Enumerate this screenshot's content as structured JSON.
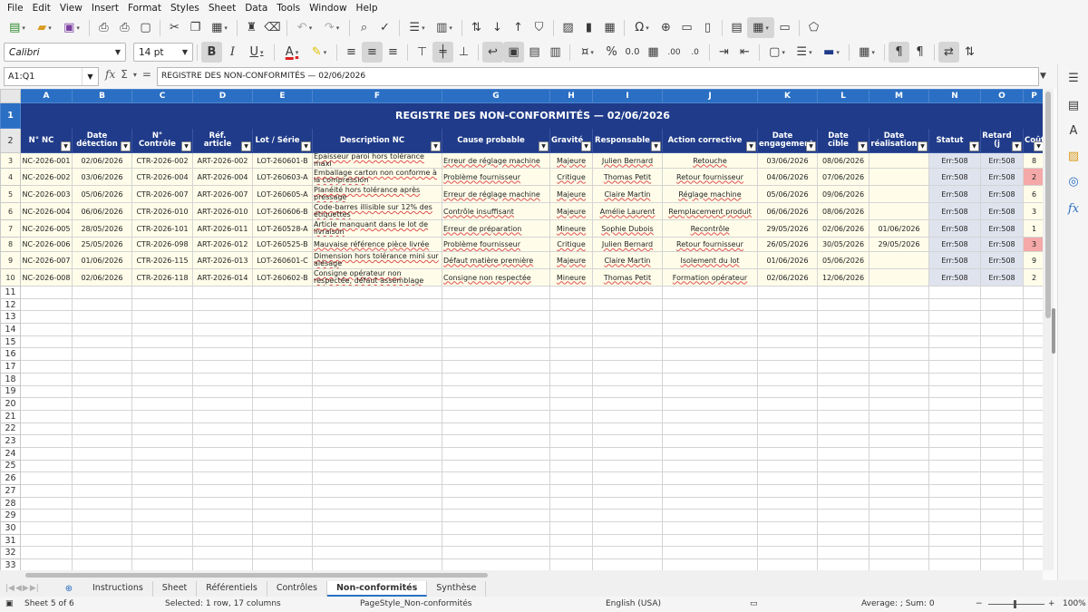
{
  "menu": [
    "File",
    "Edit",
    "View",
    "Insert",
    "Format",
    "Styles",
    "Sheet",
    "Data",
    "Tools",
    "Window",
    "Help"
  ],
  "format_bar": {
    "font_name": "Calibri",
    "font_size": "14 pt"
  },
  "formula_bar": {
    "name_box": "A1:Q1",
    "formula": "REGISTRE DES NON-CONFORMITÉS — 02/06/2026"
  },
  "columns": [
    "A",
    "B",
    "C",
    "D",
    "E",
    "F",
    "G",
    "H",
    "I",
    "J",
    "K",
    "L",
    "M",
    "N",
    "O",
    "P"
  ],
  "sheet": {
    "title": "REGISTRE DES NON-CONFORMITÉS — 02/06/2026",
    "headers": [
      "N° NC",
      "Date détection",
      "N° Contrôle",
      "Réf. article",
      "Lot / Série",
      "Description NC",
      "Cause probable",
      "Gravité",
      "Responsable",
      "Action corrective",
      "Date engagement",
      "Date cible",
      "Date réalisation",
      "Statut",
      "Retard (j",
      "Coût"
    ],
    "rows": [
      [
        "NC-2026-001",
        "02/06/2026",
        "CTR-2026-002",
        "ART-2026-002",
        "LOT-260601-B",
        "Épaisseur paroi hors tolérance maxi",
        "Erreur de réglage machine",
        "Majeure",
        "Julien Bernard",
        "Retouche",
        "03/06/2026",
        "08/06/2026",
        "",
        "Err:508",
        "Err:508",
        "8"
      ],
      [
        "NC-2026-002",
        "03/06/2026",
        "CTR-2026-004",
        "ART-2026-004",
        "LOT-260603-A",
        "Emballage carton non conforme à la compression",
        "Problème fournisseur",
        "Critique",
        "Thomas Petit",
        "Retour fournisseur",
        "04/06/2026",
        "07/06/2026",
        "",
        "Err:508",
        "Err:508",
        "2"
      ],
      [
        "NC-2026-003",
        "05/06/2026",
        "CTR-2026-007",
        "ART-2026-007",
        "LOT-260605-A",
        "Planéité hors tolérance après pressage",
        "Erreur de réglage machine",
        "Majeure",
        "Claire Martin",
        "Réglage machine",
        "05/06/2026",
        "09/06/2026",
        "",
        "Err:508",
        "Err:508",
        "6"
      ],
      [
        "NC-2026-004",
        "06/06/2026",
        "CTR-2026-010",
        "ART-2026-010",
        "LOT-260606-B",
        "Code-barres illisible sur 12% des étiquettes",
        "Contrôle insuffisant",
        "Majeure",
        "Amélie Laurent",
        "Remplacement produit",
        "06/06/2026",
        "08/06/2026",
        "",
        "Err:508",
        "Err:508",
        "3"
      ],
      [
        "NC-2026-005",
        "28/05/2026",
        "CTR-2026-101",
        "ART-2026-011",
        "LOT-260528-A",
        "Article manquant dans le lot de livraison",
        "Erreur de préparation",
        "Mineure",
        "Sophie Dubois",
        "Recontrôle",
        "29/05/2026",
        "02/06/2026",
        "01/06/2026",
        "Err:508",
        "Err:508",
        "1"
      ],
      [
        "NC-2026-006",
        "25/05/2026",
        "CTR-2026-098",
        "ART-2026-012",
        "LOT-260525-B",
        "Mauvaise référence pièce livrée",
        "Problème fournisseur",
        "Critique",
        "Julien Bernard",
        "Retour fournisseur",
        "26/05/2026",
        "30/05/2026",
        "29/05/2026",
        "Err:508",
        "Err:508",
        "3"
      ],
      [
        "NC-2026-007",
        "01/06/2026",
        "CTR-2026-115",
        "ART-2026-013",
        "LOT-260601-C",
        "Dimension hors tolérance mini sur alésage",
        "Défaut matière première",
        "Majeure",
        "Claire Martin",
        "Isolement du lot",
        "01/06/2026",
        "05/06/2026",
        "",
        "Err:508",
        "Err:508",
        "9"
      ],
      [
        "NC-2026-008",
        "02/06/2026",
        "CTR-2026-118",
        "ART-2026-014",
        "LOT-260602-B",
        "Consigne opérateur non respectée, défaut assemblage",
        "Consigne non respectée",
        "Mineure",
        "Thomas Petit",
        "Formation opérateur",
        "02/06/2026",
        "12/06/2026",
        "",
        "Err:508",
        "Err:508",
        "2"
      ]
    ],
    "empty_rows": [
      "11",
      "12",
      "13",
      "14",
      "15",
      "16",
      "17",
      "18",
      "19",
      "20",
      "21",
      "22",
      "23",
      "24",
      "25",
      "26",
      "27",
      "28",
      "29",
      "30",
      "31",
      "32",
      "33"
    ]
  },
  "tabs": [
    "Instructions",
    "Sheet",
    "Référentiels",
    "Contrôles",
    "Non-conformités",
    "Synthèse"
  ],
  "active_tab": "Non-conformités",
  "status": {
    "sheet": "Sheet 5 of 6",
    "selection": "Selected: 1 row, 17 columns",
    "page_style": "PageStyle_Non-conformités",
    "language": "English (USA)",
    "sum": "Average: ; Sum: 0",
    "zoom": "100%"
  },
  "colors": {
    "title_bg": "#1f3b89",
    "header_bg": "#1f3b89",
    "col_header_selected": "#2a6fc4",
    "data_bg": "#fffde9",
    "status_cell_bg": "#dfe3ee",
    "alert_bg": "#f4a8a8"
  }
}
